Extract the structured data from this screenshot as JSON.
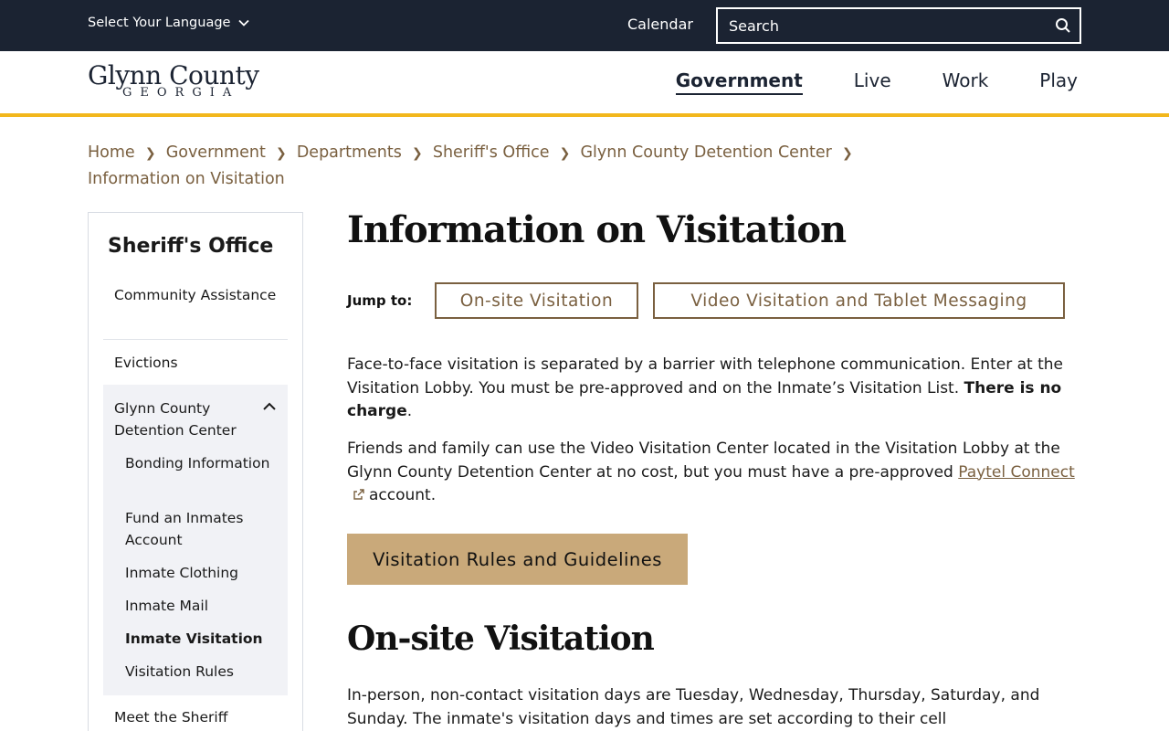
{
  "topbar": {
    "language_label": "Select Your Language",
    "calendar_label": "Calendar",
    "search_placeholder": "Search"
  },
  "header": {
    "logo_name": "Glynn County",
    "logo_state": "GEORGIA",
    "nav": [
      "Government",
      "Live",
      "Work",
      "Play"
    ],
    "active_nav": "Government"
  },
  "breadcrumb": [
    "Home",
    "Government",
    "Departments",
    "Sheriff's Office",
    "Glynn County Detention Center",
    "Information on Visitation"
  ],
  "sidebar": {
    "title": "Sheriff's Office",
    "items": [
      "Community Assistance",
      "Evictions",
      "Glynn County Detention Center",
      "Meet the Sheriff"
    ],
    "subitems": [
      "Bonding Information",
      "Fund an Inmates Account",
      "Inmate Clothing",
      "Inmate Mail",
      "Inmate Visitation",
      "Visitation Rules"
    ],
    "current_subitem": "Inmate Visitation"
  },
  "main": {
    "title": "Information on Visitation",
    "jump_label": "Jump to:",
    "jump_links": [
      "On-site Visitation",
      "Video Visitation and Tablet Messaging"
    ],
    "para1_text": "Face-to-face visitation is separated by a barrier with telephone communication. Enter at the Visitation Lobby. You must be pre-approved and on the Inmate’s Visitation List.",
    "para1_bold": "There is no charge",
    "para1_end": ".",
    "para2_text": "Friends and family can use the Video Visitation Center located in the Visitation Lobby at the Glynn County Detention Center at no cost, but you must have a pre-approved",
    "para2_link": "Paytel Connect",
    "para2_end": "account.",
    "cta_label": "Visitation Rules and Guidelines",
    "section_title": "On-site Visitation",
    "para3_text": "In-person, non-contact visitation days are Tuesday, Wednesday, Thursday, Saturday, and Sunday. The inmate's visitation days and times are set according to their cell"
  },
  "colors": {
    "topbar_bg": "#1b2332",
    "accent_gold": "#f2b71c",
    "link_brown": "#7a6040",
    "cta_bg": "#c9a97a"
  }
}
